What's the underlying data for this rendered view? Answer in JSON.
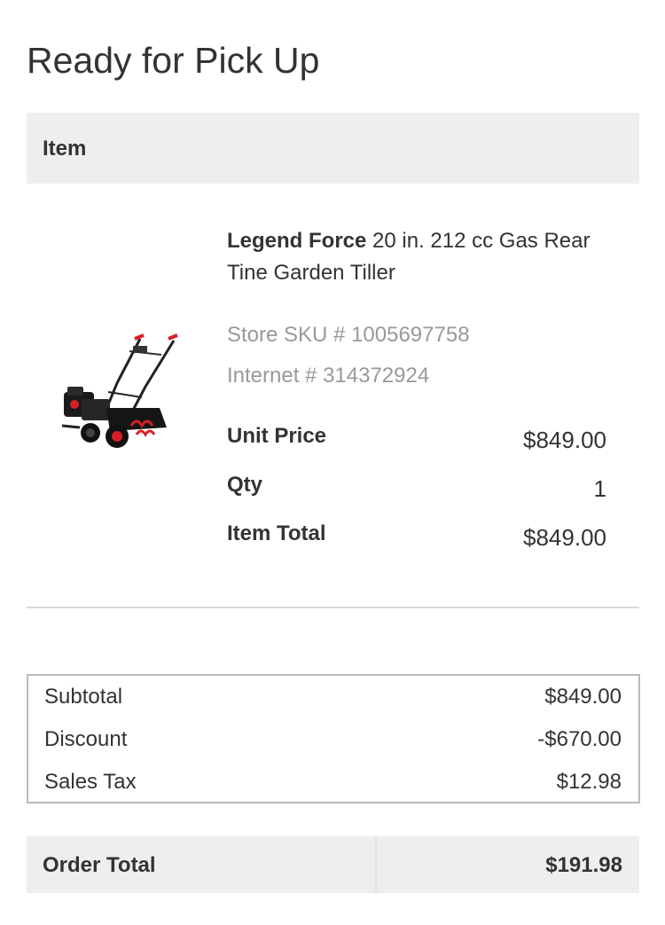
{
  "page": {
    "title": "Ready for Pick Up"
  },
  "items_table": {
    "header": "Item"
  },
  "item": {
    "brand": "Legend Force",
    "name": "20 in. 212 cc Gas Rear Tine Garden Tiller",
    "image_icon": "garden-tiller-product-image",
    "store_sku": "Store SKU # 1005697758",
    "internet_number": "Internet # 314372924",
    "unit_price_label": "Unit Price",
    "unit_price": "$849.00",
    "qty_label": "Qty",
    "qty": "1",
    "item_total_label": "Item Total",
    "item_total": "$849.00"
  },
  "summary": {
    "subtotal_label": "Subtotal",
    "subtotal": "$849.00",
    "discount_label": "Discount",
    "discount": "-$670.00",
    "sales_tax_label": "Sales Tax",
    "sales_tax": "$12.98"
  },
  "order_total": {
    "label": "Order Total",
    "value": "$191.98"
  },
  "colors": {
    "header_bg": "#eeeeee",
    "muted_text": "#999999",
    "text": "#333333",
    "tiller_accent": "#d81f26"
  }
}
